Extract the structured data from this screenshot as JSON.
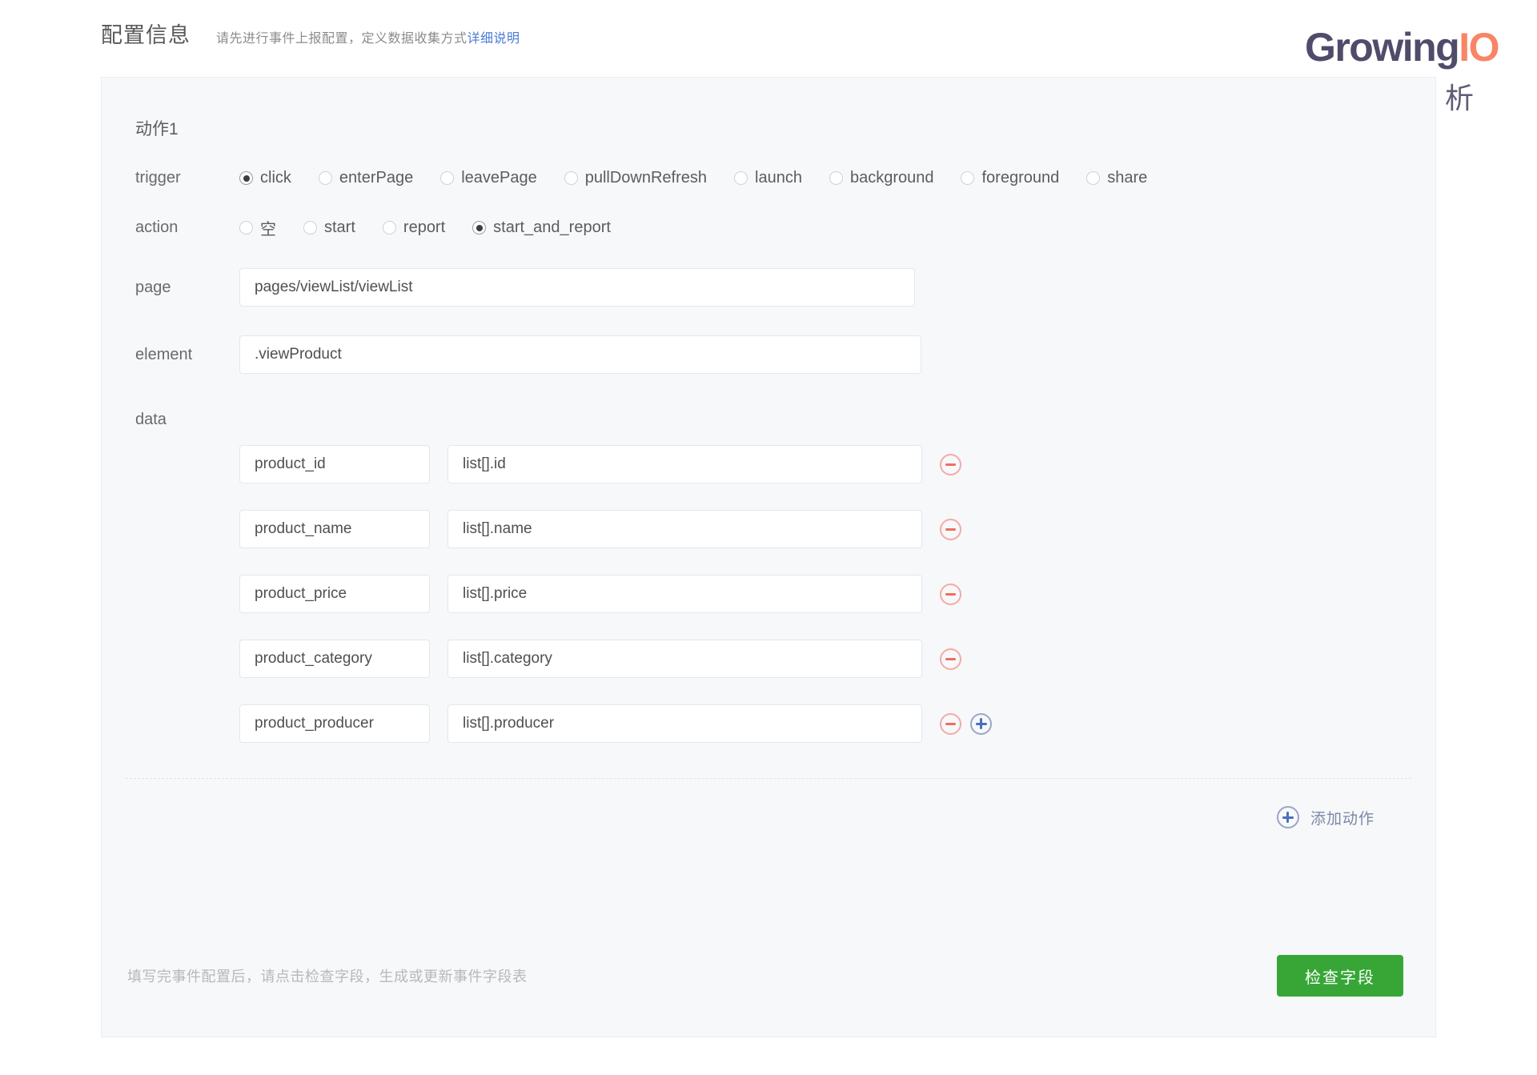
{
  "header": {
    "title": "配置信息",
    "subtitle": "请先进行事件上报配置，定义数据收集方式",
    "doc_link": "详细说明"
  },
  "brand": {
    "name_primary": "Growing",
    "name_accent": "IO",
    "tagline": "数据分析",
    "color_primary": "#514b6b",
    "color_accent": "#f98566"
  },
  "action_block": {
    "title": "动作1",
    "trigger": {
      "label": "trigger",
      "selected": "click",
      "options": [
        {
          "label": "click",
          "selected": true
        },
        {
          "label": "enterPage",
          "selected": false
        },
        {
          "label": "leavePage",
          "selected": false
        },
        {
          "label": "pullDownRefresh",
          "selected": false
        },
        {
          "label": "launch",
          "selected": false
        },
        {
          "label": "background",
          "selected": false
        },
        {
          "label": "foreground",
          "selected": false
        },
        {
          "label": "share",
          "selected": false
        }
      ]
    },
    "action": {
      "label": "action",
      "selected": "start_and_report",
      "options": [
        {
          "label": "空",
          "selected": false
        },
        {
          "label": "start",
          "selected": false
        },
        {
          "label": "report",
          "selected": false
        },
        {
          "label": "start_and_report",
          "selected": true
        }
      ]
    },
    "page": {
      "label": "page",
      "value": "pages/viewList/viewList"
    },
    "element": {
      "label": "element",
      "value": ".viewProduct"
    },
    "data": {
      "label": "data",
      "rows": [
        {
          "key": "product_id",
          "value": "list[].id",
          "has_add": false
        },
        {
          "key": "product_name",
          "value": "list[].name",
          "has_add": false
        },
        {
          "key": "product_price",
          "value": "list[].price",
          "has_add": false
        },
        {
          "key": "product_category",
          "value": "list[].category",
          "has_add": false
        },
        {
          "key": "product_producer",
          "value": "list[].producer",
          "has_add": true
        }
      ]
    }
  },
  "add_action": {
    "label": "添加动作"
  },
  "footer": {
    "hint": "填写完事件配置后，请点击检查字段，生成或更新事件字段表",
    "submit_label": "检查字段",
    "submit_color": "#37a637"
  }
}
